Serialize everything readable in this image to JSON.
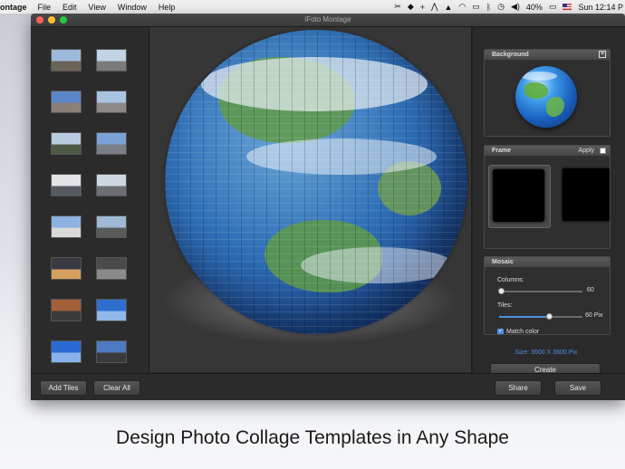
{
  "menubar": {
    "app_name": "ontage",
    "items": [
      "File",
      "Edit",
      "View",
      "Window",
      "Help"
    ],
    "battery": "40%",
    "clock": "Sun 12:14 P"
  },
  "window": {
    "title": "iFoto Montage"
  },
  "sidebar": {
    "thumbnails": [
      {
        "sky": "#9db9da",
        "ground": "#6b6458"
      },
      {
        "sky": "#c3d3e6",
        "ground": "#7c7a78"
      },
      {
        "sky": "#5c86c7",
        "ground": "#8a8078"
      },
      {
        "sky": "#a9c3e3",
        "ground": "#8c8a88"
      },
      {
        "sky": "#b9ccdf",
        "ground": "#4e5a45"
      },
      {
        "sky": "#7aa2d6",
        "ground": "#7a7f86"
      },
      {
        "sky": "#e4e4e6",
        "ground": "#555a60"
      },
      {
        "sky": "#cfd8e2",
        "ground": "#6b6f73"
      },
      {
        "sky": "#8db1e0",
        "ground": "#d8d8d8"
      },
      {
        "sky": "#9fb8d6",
        "ground": "#5a5a5a"
      },
      {
        "sky": "#3a3a44",
        "ground": "#d6a060"
      },
      {
        "sky": "#4a4a4a",
        "ground": "#8a8a8a"
      },
      {
        "sky": "#a35f3a",
        "ground": "#3a3a3a"
      },
      {
        "sky": "#2e6ed0",
        "ground": "#90b8ea"
      },
      {
        "sky": "#2a6ad4",
        "ground": "#88b2ec"
      },
      {
        "sky": "#4f79c2",
        "ground": "#3a3a3a"
      }
    ]
  },
  "background_panel": {
    "title": "Background"
  },
  "frame_panel": {
    "title": "Frame",
    "apply_label": "Apply"
  },
  "mosaic_panel": {
    "title": "Mosaic",
    "columns_label": "Columns:",
    "columns_value": "60",
    "columns_level": 0.02,
    "tiles_label": "Tiles:",
    "tiles_value": "60 Pix",
    "tiles_level": 0.6,
    "match_color_label": "Match color",
    "match_color_checked": true,
    "size_text": "Size: 3600 X 3600 Pix"
  },
  "buttons": {
    "create": "Create",
    "add_tiles": "Add Tiles",
    "clear_all": "Clear All",
    "share": "Share",
    "save": "Save"
  },
  "caption": "Design Photo Collage Templates in Any Shape",
  "colors": {
    "window_bg": "#2a2a2a",
    "canvas_bg": "#363636",
    "accent_blue": "#4a8fe0",
    "size_text": "#4a8fe0"
  }
}
